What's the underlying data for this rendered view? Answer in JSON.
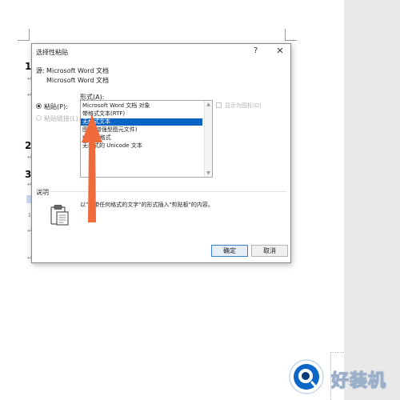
{
  "dialog": {
    "title": "选择性粘贴",
    "help": "?",
    "close": "✕",
    "source_label": "源:",
    "source_line1": "Microsoft Word 文档",
    "source_line2": "Microsoft Word 文档",
    "as_label": "形式(A):",
    "paste_option": "粘贴(P):",
    "paste_link_option": "粘贴链接(L):",
    "show_as_icon": "显示为图标(D)",
    "formats": [
      "Microsoft Word 文档 对象",
      "带格式文本(RTF)",
      "无格式文本",
      "图片(增强型图元文件)",
      "HTML 格式",
      "无格式的 Unicode 文本"
    ],
    "selected_format_index": 2,
    "description_label": "说明",
    "description_text": "以\"不带任何格式的文字\"的形式插入\"剪贴板\"的内容。",
    "ok_label": "确定",
    "cancel_label": "取消"
  },
  "document": {
    "glyphs": [
      "1",
      "2",
      "3"
    ],
    "para_mark": "↵",
    "line_number": "1"
  },
  "watermark": {
    "text": "好装机"
  },
  "colors": {
    "selection": "#0a64c4",
    "arrow": "#f06a3c",
    "side_panel": "#e9e9e9"
  }
}
